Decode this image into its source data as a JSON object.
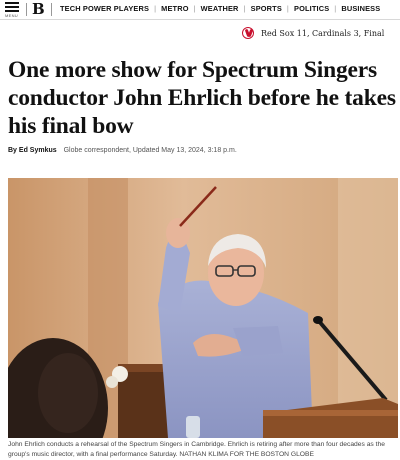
{
  "header": {
    "menu_label": "MENU",
    "logo": "B",
    "nav": [
      "TECH POWER PLAYERS",
      "METRO",
      "WEATHER",
      "SPORTS",
      "POLITICS",
      "BUSINESS"
    ]
  },
  "scoreboard": {
    "icon": "red-sox-logo",
    "text": "Red Sox 11, Cardinals 3, Final"
  },
  "article": {
    "headline": "One more show for Spectrum Singers conductor John Ehrlich before he takes his final bow",
    "byline_prefix": "By",
    "author": "Ed Symkus",
    "meta": "Globe correspondent, Updated May 13, 2024, 3:18 p.m.",
    "photo_alt": "John Ehrlich conducting with a pencil raised",
    "caption": "John Ehrlich conducts a rehearsal of the Spectrum Singers in Cambridge. Ehrlich is retiring after more than four decades as the group's music director, with a final performance Saturday. NATHAN KLIMA FOR THE BOSTON GLOBE"
  },
  "colors": {
    "accent": "#c8102e",
    "wall": "#d8ad86",
    "shirt": "#9fa7cf"
  }
}
